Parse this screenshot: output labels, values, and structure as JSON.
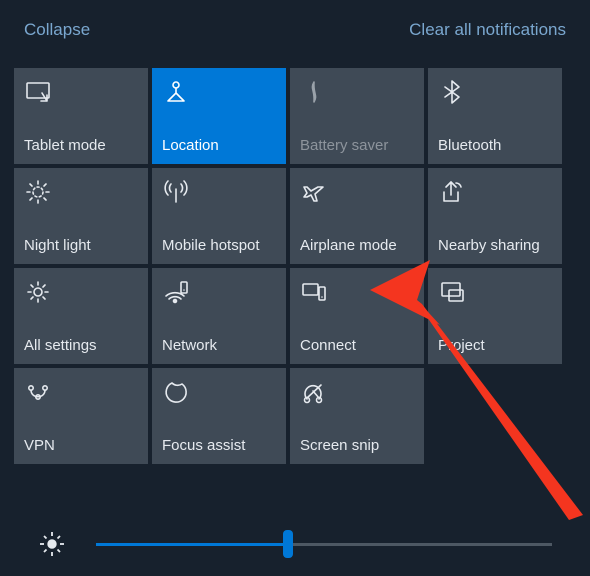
{
  "links": {
    "collapse": "Collapse",
    "clear": "Clear all notifications"
  },
  "tiles": [
    {
      "id": "tablet-mode",
      "label": "Tablet mode",
      "icon": "tablet-mode-icon",
      "state": "off"
    },
    {
      "id": "location",
      "label": "Location",
      "icon": "location-icon",
      "state": "on"
    },
    {
      "id": "battery-saver",
      "label": "Battery saver",
      "icon": "battery-saver-icon",
      "state": "disabled"
    },
    {
      "id": "bluetooth",
      "label": "Bluetooth",
      "icon": "bluetooth-icon",
      "state": "off"
    },
    {
      "id": "night-light",
      "label": "Night light",
      "icon": "night-light-icon",
      "state": "off"
    },
    {
      "id": "mobile-hotspot",
      "label": "Mobile hotspot",
      "icon": "hotspot-icon",
      "state": "off"
    },
    {
      "id": "airplane-mode",
      "label": "Airplane mode",
      "icon": "airplane-icon",
      "state": "off"
    },
    {
      "id": "nearby-sharing",
      "label": "Nearby sharing",
      "icon": "share-icon",
      "state": "off"
    },
    {
      "id": "all-settings",
      "label": "All settings",
      "icon": "settings-icon",
      "state": "off"
    },
    {
      "id": "network",
      "label": "Network",
      "icon": "network-icon",
      "state": "off"
    },
    {
      "id": "connect",
      "label": "Connect",
      "icon": "connect-icon",
      "state": "off"
    },
    {
      "id": "project",
      "label": "Project",
      "icon": "project-icon",
      "state": "off"
    },
    {
      "id": "vpn",
      "label": "VPN",
      "icon": "vpn-icon",
      "state": "off"
    },
    {
      "id": "focus-assist",
      "label": "Focus assist",
      "icon": "focus-assist-icon",
      "state": "off"
    },
    {
      "id": "screen-snip",
      "label": "Screen snip",
      "icon": "screen-snip-icon",
      "state": "off"
    }
  ],
  "brightness": {
    "value": 42,
    "min": 0,
    "max": 100
  },
  "annotation": {
    "arrow_color": "#f4351f",
    "target": "airplane-mode"
  }
}
